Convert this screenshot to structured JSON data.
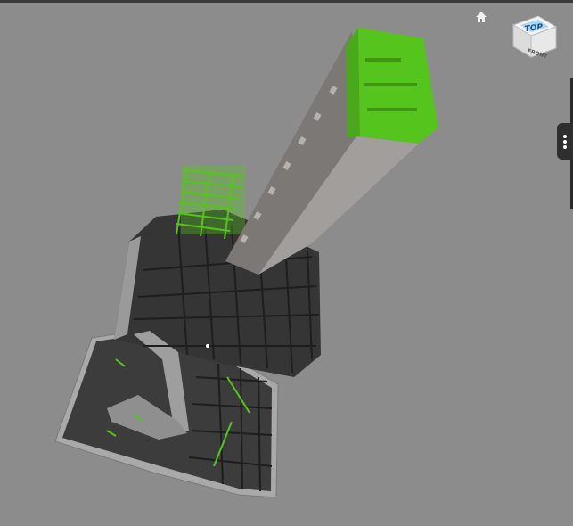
{
  "viewer": {
    "background": "#8c8c8c",
    "highlight_color": "#55c51d"
  },
  "toolbar": {
    "home_icon": "home-icon"
  },
  "viewcube": {
    "top_label": "TOP",
    "front_label": "FRONT"
  },
  "side_panel": {
    "handle_icon": "more-vertical-icon"
  }
}
